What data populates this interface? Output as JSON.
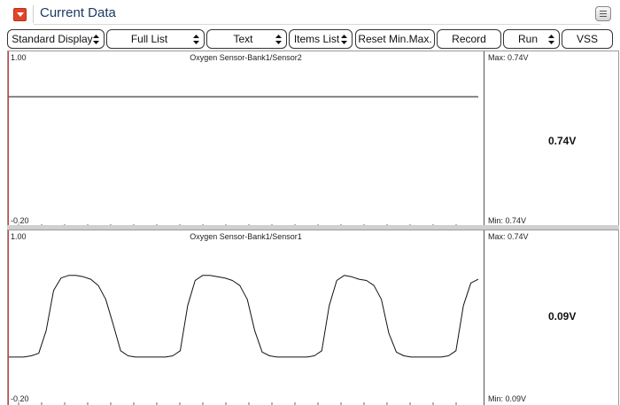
{
  "window": {
    "title": "Current Data"
  },
  "toolbar": {
    "buttons": [
      {
        "label": "Standard Display",
        "has_dropdown": true
      },
      {
        "label": "Full List",
        "has_dropdown": true
      },
      {
        "label": "Text",
        "has_dropdown": true
      },
      {
        "label": "Items List",
        "has_dropdown": true
      },
      {
        "label": "Reset Min.Max.",
        "has_dropdown": false
      },
      {
        "label": "Record",
        "has_dropdown": false
      },
      {
        "label": "Run",
        "has_dropdown": true
      },
      {
        "label": "VSS",
        "has_dropdown": false
      }
    ]
  },
  "graphs": [
    {
      "title": "Oxygen Sensor-Bank1/Sensor2",
      "y_max_label": "1.00",
      "y_min_label": "-0.20",
      "max_label": "Max:  0.74V",
      "min_label": "Min:  0.74V",
      "current_value": "0.74V",
      "ylim": [
        -0.2,
        1.0
      ],
      "samples": [
        0.74,
        0.74,
        0.74,
        0.74,
        0.74,
        0.74,
        0.74,
        0.74,
        0.74,
        0.74,
        0.74,
        0.74,
        0.74,
        0.74,
        0.74,
        0.74,
        0.74
      ]
    },
    {
      "title": "Oxygen Sensor-Bank1/Sensor1",
      "y_max_label": "1.00",
      "y_min_label": "-0.20",
      "max_label": "Max:  0.74V",
      "min_label": "Min:  0.09V",
      "current_value": "0.09V",
      "ylim": [
        -0.2,
        1.0
      ],
      "samples": [
        0.09,
        0.09,
        0.09,
        0.1,
        0.12,
        0.3,
        0.62,
        0.72,
        0.74,
        0.74,
        0.73,
        0.71,
        0.66,
        0.55,
        0.35,
        0.14,
        0.1,
        0.09,
        0.09,
        0.09,
        0.09,
        0.09,
        0.1,
        0.14,
        0.5,
        0.7,
        0.74,
        0.74,
        0.73,
        0.72,
        0.7,
        0.66,
        0.55,
        0.3,
        0.13,
        0.1,
        0.09,
        0.09,
        0.09,
        0.09,
        0.09,
        0.1,
        0.14,
        0.5,
        0.7,
        0.74,
        0.73,
        0.71,
        0.7,
        0.66,
        0.55,
        0.28,
        0.13,
        0.1,
        0.09,
        0.09,
        0.09,
        0.09,
        0.09,
        0.1,
        0.14,
        0.5,
        0.68,
        0.71
      ]
    }
  ]
}
